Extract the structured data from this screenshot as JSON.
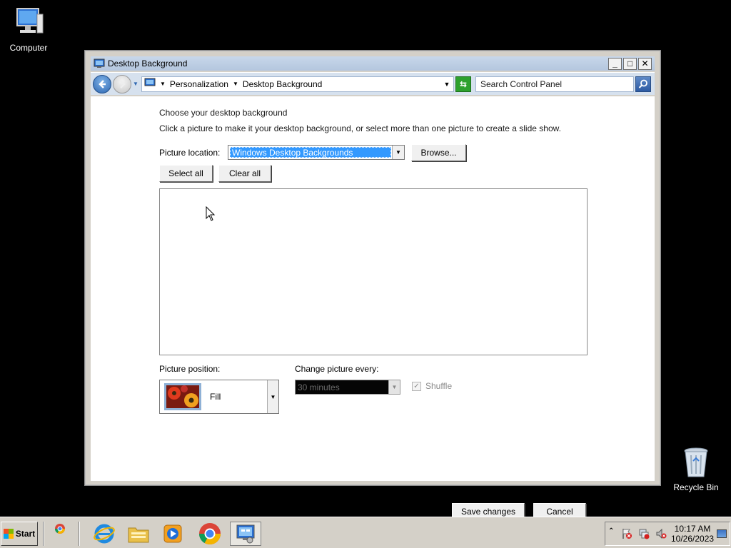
{
  "desktop": {
    "icons": [
      {
        "label": "Computer"
      },
      {
        "label": "Recycle Bin"
      }
    ]
  },
  "window": {
    "title": "Desktop Background",
    "address": {
      "crumbs": [
        "Personalization",
        "Desktop Background"
      ]
    },
    "search": {
      "placeholder": "Search Control Panel"
    },
    "heading": "Choose your desktop background",
    "description": "Click a picture to make it your desktop background, or select more than one picture to create a slide show.",
    "picture_location": {
      "label": "Picture location:",
      "selected": "Windows Desktop Backgrounds"
    },
    "browse_label": "Browse...",
    "select_all_label": "Select all",
    "clear_all_label": "Clear all",
    "picture_position": {
      "label": "Picture position:",
      "selected": "Fill"
    },
    "change_picture": {
      "label": "Change picture every:",
      "selected": "30 minutes"
    },
    "shuffle_label": "Shuffle",
    "save_label": "Save changes",
    "cancel_label": "Cancel"
  },
  "taskbar": {
    "start_label": "Start",
    "clock": {
      "time": "10:17 AM",
      "date": "10/26/2023"
    }
  },
  "colors": {
    "selection": "#3399ff",
    "addressbar": "#d6e1ee",
    "titlebar": "#c8d7ea"
  }
}
